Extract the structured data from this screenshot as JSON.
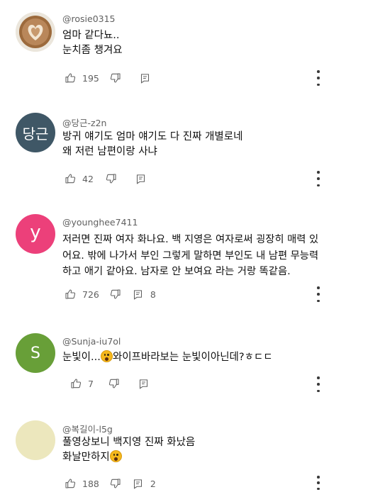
{
  "comments": [
    {
      "author": "@rosie0315",
      "lines": [
        "엄마 같다뇨..",
        "눈치좀 챙겨요"
      ],
      "likes": "195",
      "replies": "",
      "avatar": {
        "kind": "latte-art",
        "bg": "#c9a27a",
        "text": ""
      }
    },
    {
      "author": "@당근-z2n",
      "lines": [
        "방귀 얘기도 엄마 얘기도 다 진짜 개별로네",
        "왜 저런 남편이랑 사냐"
      ],
      "likes": "42",
      "replies": "",
      "avatar": {
        "kind": "letter",
        "bg": "#3f5766",
        "text": "당근"
      }
    },
    {
      "author": "@younghee7411",
      "lines": [
        "저러면 진짜 여자 화나요. 백 지영은 여자로써 굉장히 매력 있",
        "어요. 밖에 나가서 부인 그렇게 말하면 부인도 내 남편 무능력",
        "하고 애기 같아요.  남자로 안 보여요 라는 거랑 똑같음."
      ],
      "likes": "726",
      "replies": "8",
      "avatar": {
        "kind": "letter",
        "bg": "#ec407a",
        "text": "y"
      }
    },
    {
      "author": "@Sunja-iu7ol",
      "line_parts": {
        "before": "눈빛이...",
        "after": "와이프바라보는 눈빛이아닌데?ㅎㄷㄷ"
      },
      "likes": "7",
      "replies": "",
      "avatar": {
        "kind": "letter",
        "bg": "#689f38",
        "text": "S"
      }
    },
    {
      "author": "@복길이-l5g",
      "lines_with_emoji": {
        "line1": "풀영상보니 백지영 진짜 화났음",
        "line2": "화날만하지"
      },
      "likes": "188",
      "replies": "2",
      "avatar": {
        "kind": "blank",
        "bg": "#ece7bd",
        "text": ""
      }
    }
  ],
  "icons": {
    "like": "thumbs-up-icon",
    "dislike": "thumbs-down-icon",
    "reply": "reply-icon",
    "more": "more-vertical-icon",
    "emoji": "astonished-face-emoji"
  },
  "colors": {
    "text": "#0f0f0f",
    "meta": "#606060"
  }
}
